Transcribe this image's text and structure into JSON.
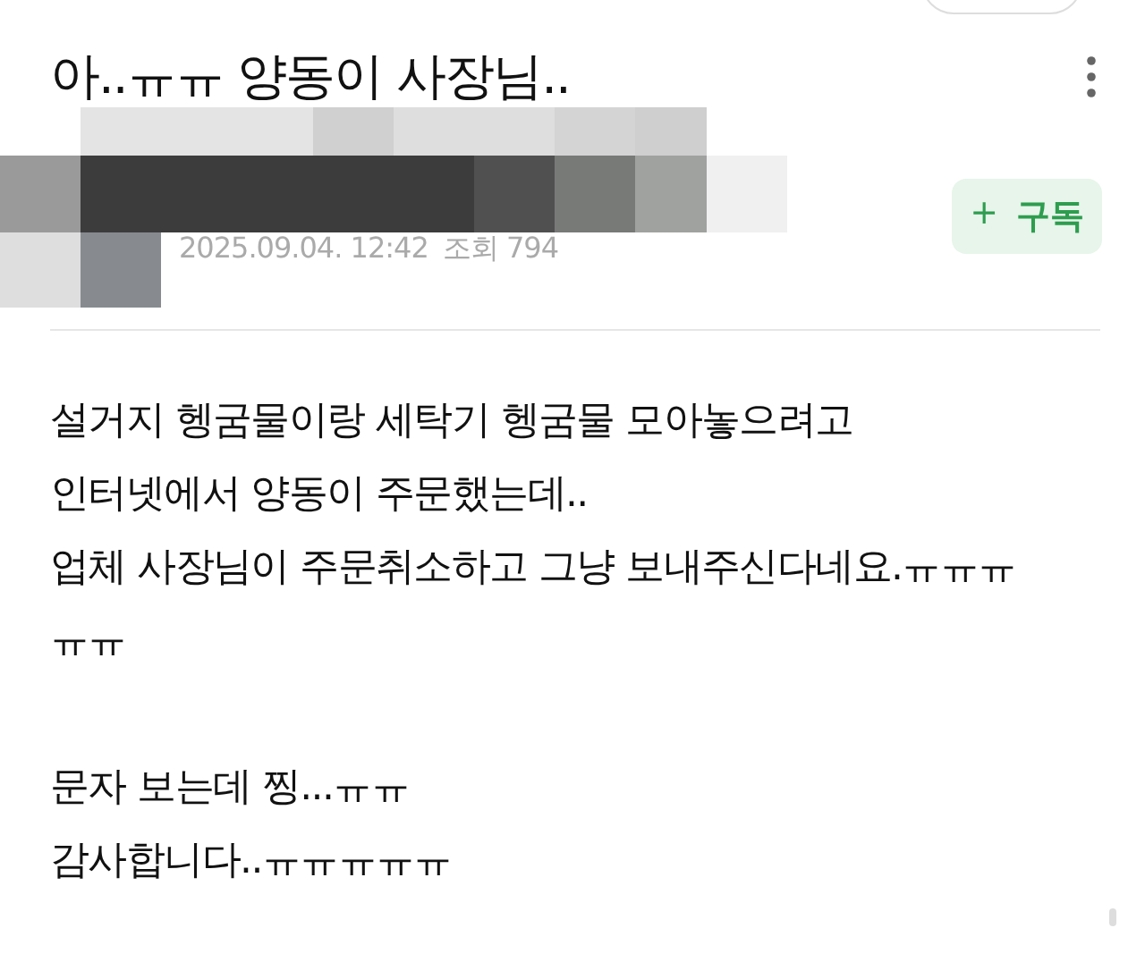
{
  "post": {
    "title": "아..ㅠㅠ 양동이 사장님..",
    "meta": {
      "date": "2025.09.04. 12:42",
      "views": "조회 794"
    },
    "subscribe": {
      "icon": "+",
      "label": "구독"
    },
    "body": [
      [
        "설거지 헹굼물이랑 세탁기 헹굼물 모아놓으려고",
        "인터넷에서 양동이 주문했는데..",
        "업체 사장님이 주문취소하고 그냥 보내주신다네요.ㅠㅠㅠ",
        "ㅠㅠ"
      ],
      [
        "문자 보는데 찡...ㅠㅠ",
        "감사합니다..ㅠㅠㅠㅠㅠ"
      ]
    ]
  }
}
